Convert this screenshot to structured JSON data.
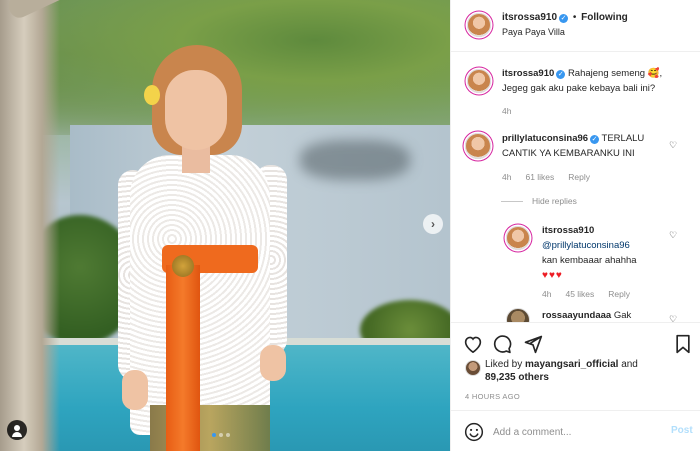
{
  "header": {
    "username": "itsrossa910",
    "separator": "•",
    "follow_status": "Following",
    "location": "Paya Paya Villa",
    "more_icon": "more-horizontal-icon"
  },
  "caption": {
    "username": "itsrossa910",
    "text_line1": "Rahajeng semeng 🥰,",
    "text_line2": "Jegeg gak aku pake kebaya bali ini?",
    "time": "4h"
  },
  "comments": [
    {
      "username": "prillylatuconsina96",
      "text_line1": "TERLALU",
      "text_line2": "CANTIK YA KEMBARANKU INI",
      "time": "4h",
      "likes": "61 likes",
      "reply": "Reply",
      "hide_replies": "Hide replies"
    }
  ],
  "reply": {
    "username": "itsrossa910",
    "mention": "@prillylatuconsina96",
    "text": "kan kembaaar ahahha",
    "hearts": "♥♥♥",
    "time": "4h",
    "likes": "45 likes",
    "reply": "Reply"
  },
  "partial_comment": {
    "username": "rossaayundaaa",
    "text": "Gak"
  },
  "actions": {
    "like_icon": "heart-outline-icon",
    "comment_icon": "comment-icon",
    "share_icon": "send-icon",
    "save_icon": "bookmark-icon"
  },
  "likes": {
    "prefix": "Liked by",
    "user": "mayangsari_official",
    "conj": "and",
    "count": "89,235 others"
  },
  "timestamp": "4 HOURS AGO",
  "add_comment": {
    "placeholder": "Add a comment...",
    "post_label": "Post",
    "emoji_icon": "smiley-icon"
  },
  "colors": {
    "verified": "#3897f0",
    "post_disabled": "#b2dffc",
    "heart": "#ed1c24"
  }
}
